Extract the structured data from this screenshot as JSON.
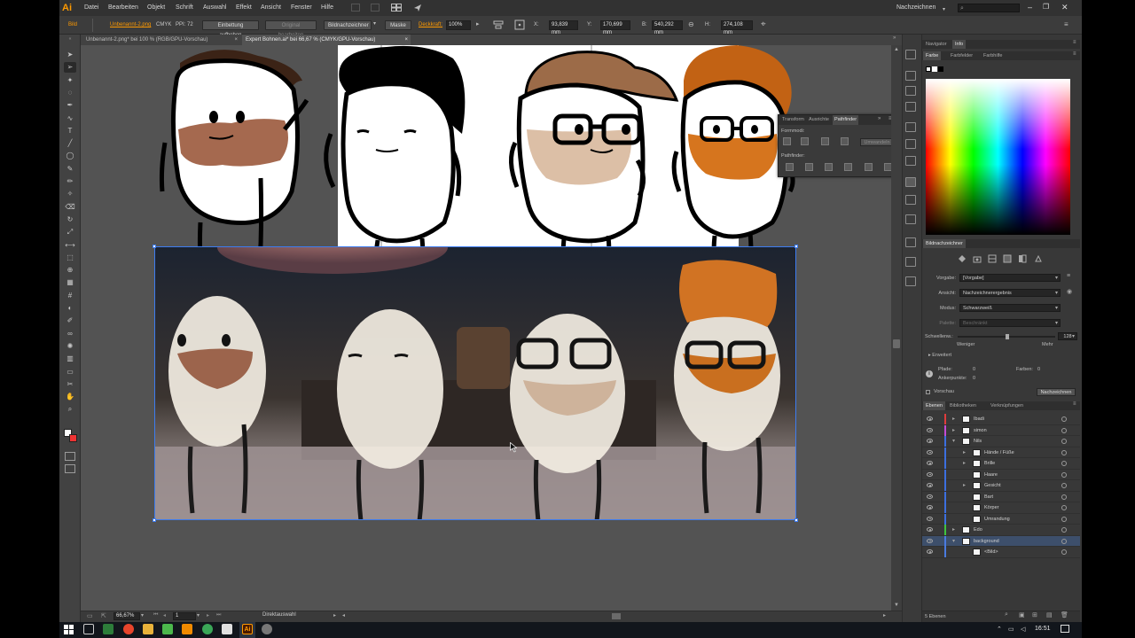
{
  "app": {
    "logo": "Ai",
    "menu": [
      "Datei",
      "Bearbeiten",
      "Objekt",
      "Schrift",
      "Auswahl",
      "Effekt",
      "Ansicht",
      "Fenster",
      "Hilfe"
    ],
    "workspace": "Nachzeichnen",
    "search_placeholder": ""
  },
  "control_bar": {
    "object_type": "Bild",
    "file_link": "Unbenannt-2.png",
    "color_mode": "CMYK",
    "ppi": "PPI: 72",
    "embed_button": "Einbettung aufheben",
    "edit_original": "Original bearbeiten",
    "trace_button": "Bildnachzeichner",
    "mask_button": "Maske",
    "opacity_label": "Deckkraft:",
    "opacity_value": "100%",
    "x_value": "93,839 mm",
    "y_value": "170,699 mm",
    "w_value": "540,292 mm",
    "h_value": "274,108 mm"
  },
  "tabs": [
    {
      "label": "Unbenannt-2.png* bei 100 % (RGB/GPU-Vorschau)",
      "active": false
    },
    {
      "label": "Expert Bohnen.ai* bei 66,67 % (CMYK/GPU-Vorschau)",
      "active": true
    }
  ],
  "status": {
    "zoom": "66,67%",
    "page": "1",
    "tool": "Direktauswahl"
  },
  "pathfinder": {
    "tabs": [
      "Transform",
      "Ausrichte",
      "Pathfinder"
    ],
    "active_tab": "Pathfinder",
    "shape_modes_label": "Formmodi:",
    "expand_button": "Umwandeln",
    "pathfinders_label": "Pathfinder:"
  },
  "info_panel": {
    "tabs": [
      "Navigator",
      "Info"
    ],
    "active_tab": "Info"
  },
  "color_panel": {
    "tabs": [
      "Farbe",
      "Farbfelder",
      "Farbhilfe"
    ],
    "active_tab": "Farbe"
  },
  "image_trace": {
    "title": "Bildnachzeichner",
    "preset_label": "Vorgabe:",
    "preset_value": "[Vorgabe]",
    "view_label": "Ansicht:",
    "view_value": "Nachzeichnerergebnis",
    "mode_label": "Modus:",
    "mode_value": "Schwarzweiß",
    "palette_label": "Palette:",
    "palette_value": "Beschränkt",
    "threshold_label": "Schwellenw.:",
    "threshold_value": "128",
    "less_label": "Weniger",
    "more_label": "Mehr",
    "advanced_label": "Erweitert",
    "paths_label": "Pfade:",
    "paths_value": "0",
    "colors_label": "Farben:",
    "colors_value": "0",
    "anchors_label": "Ankerpunkte:",
    "anchors_value": "0",
    "preview_label": "Vorschau",
    "trace_button": "Nachzeichnen"
  },
  "layers_panel": {
    "tabs": [
      "Ebenen",
      "Bibliotheken",
      "Verknüpfungen"
    ],
    "active_tab": "Ebenen",
    "layers": [
      {
        "name": "Ibadi",
        "color": "#e03c3c",
        "depth": 0,
        "twisty": "▸",
        "selected": false
      },
      {
        "name": "simon",
        "color": "#c44bd6",
        "depth": 0,
        "twisty": "▸",
        "selected": false
      },
      {
        "name": "Nils",
        "color": "#3c6fe0",
        "depth": 0,
        "twisty": "▾",
        "selected": false
      },
      {
        "name": "Hände / Füße",
        "color": "#3c6fe0",
        "depth": 1,
        "twisty": "▸",
        "selected": false
      },
      {
        "name": "Brille",
        "color": "#3c6fe0",
        "depth": 1,
        "twisty": "▸",
        "selected": false
      },
      {
        "name": "Haare",
        "color": "#3c6fe0",
        "depth": 1,
        "twisty": "",
        "selected": false
      },
      {
        "name": "Gesicht",
        "color": "#3c6fe0",
        "depth": 1,
        "twisty": "▸",
        "selected": false
      },
      {
        "name": "Bart",
        "color": "#3c6fe0",
        "depth": 1,
        "twisty": "",
        "selected": false
      },
      {
        "name": "Körper",
        "color": "#3c6fe0",
        "depth": 1,
        "twisty": "",
        "selected": false
      },
      {
        "name": "Umrandung",
        "color": "#3c6fe0",
        "depth": 1,
        "twisty": "",
        "selected": false
      },
      {
        "name": "Edo",
        "color": "#3fc43f",
        "depth": 0,
        "twisty": "▸",
        "selected": false
      },
      {
        "name": "background",
        "color": "#4a7be0",
        "depth": 0,
        "twisty": "▾",
        "selected": true
      },
      {
        "name": "<Bild>",
        "color": "#4a7be0",
        "depth": 1,
        "twisty": "",
        "selected": false
      }
    ],
    "footer": "5 Ebenen"
  },
  "taskbar": {
    "time": "16:51"
  },
  "colors": {
    "accent_orange": "#ff9a00",
    "selection_blue": "#3d7cf0"
  }
}
